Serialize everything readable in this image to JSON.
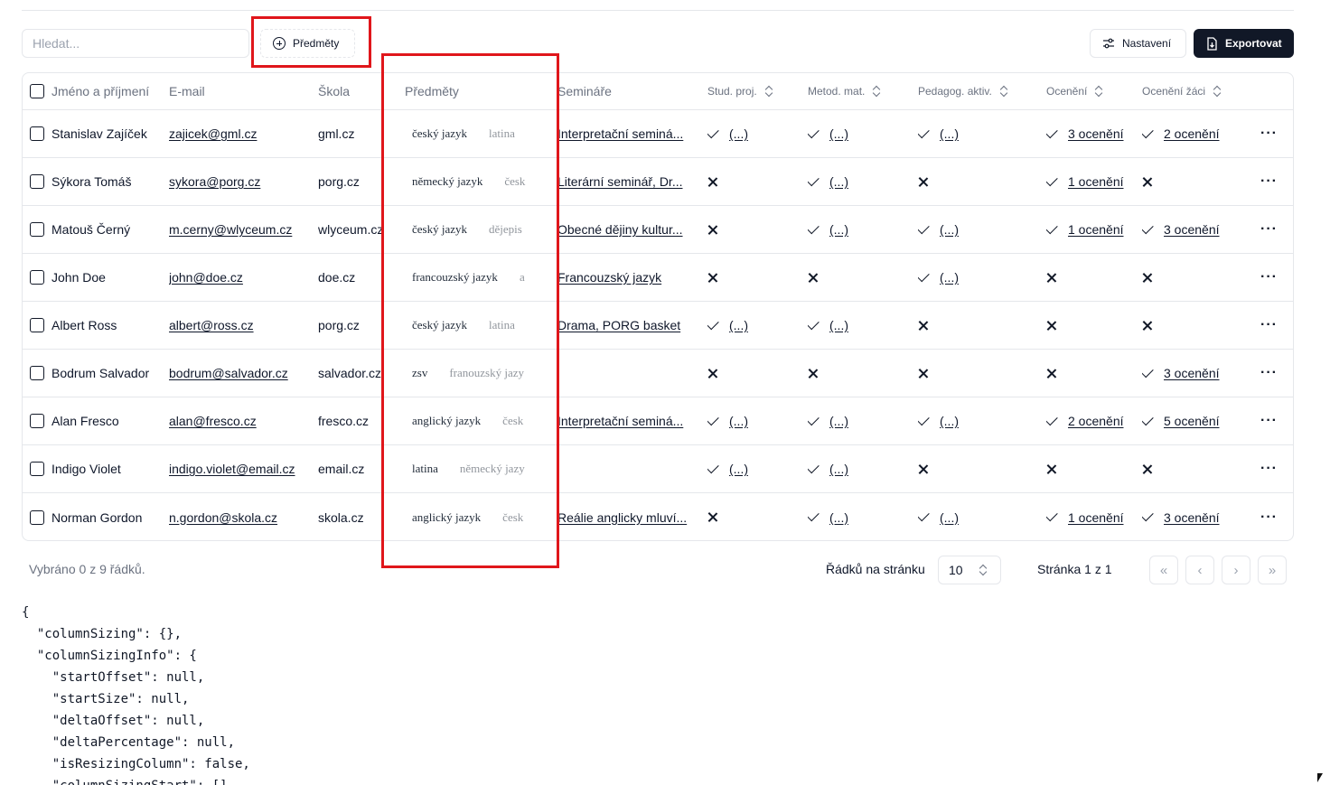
{
  "toolbar": {
    "search_placeholder": "Hledat...",
    "facet_label": "Předměty",
    "settings_label": "Nastavení",
    "export_label": "Exportovat"
  },
  "table": {
    "columns": {
      "name": "Jméno a příjmení",
      "email": "E-mail",
      "school": "Škola",
      "subjects": "Předměty",
      "seminars": "Semináře",
      "stud_proj": "Stud. proj.",
      "metod_mat": "Metod. mat.",
      "pedagog_aktiv": "Pedagog. aktiv.",
      "oceneni": "Ocenění",
      "oceneni_zaci": "Ocenění žáci"
    },
    "ellipsis_label": "(...)",
    "rows": [
      {
        "name": "Stanislav Zajíček",
        "email": "zajicek@gml.cz",
        "school": "gml.cz",
        "subject1": "český jazyk",
        "subject2": "latina",
        "seminar": "Interpretační seminá...",
        "stud_proj": true,
        "metod_mat": true,
        "pedagog": true,
        "oceneni": "3 ocenění",
        "oceneni_zaci": "2 ocenění"
      },
      {
        "name": "Sýkora Tomáš",
        "email": "sykora@porg.cz",
        "school": "porg.cz",
        "subject1": "německý jazyk",
        "subject2": "česk",
        "seminar": "Literární seminář, Dr...",
        "stud_proj": false,
        "metod_mat": true,
        "pedagog": false,
        "oceneni": "1 ocenění",
        "oceneni_zaci": ""
      },
      {
        "name": "Matouš Černý",
        "email": "m.cerny@wlyceum.cz",
        "school": "wlyceum.cz",
        "subject1": "český jazyk",
        "subject2": "dějepis",
        "seminar": "Obecné dějiny kultur...",
        "stud_proj": false,
        "metod_mat": true,
        "pedagog": true,
        "oceneni": "1 ocenění",
        "oceneni_zaci": "3 ocenění"
      },
      {
        "name": "John Doe",
        "email": "john@doe.cz",
        "school": "doe.cz",
        "subject1": "francouzský jazyk",
        "subject2": "a",
        "seminar": "Francouzský jazyk",
        "stud_proj": false,
        "metod_mat": false,
        "pedagog": true,
        "oceneni": "",
        "oceneni_zaci": ""
      },
      {
        "name": "Albert Ross",
        "email": "albert@ross.cz",
        "school": "porg.cz",
        "subject1": "český jazyk",
        "subject2": "latina",
        "seminar": "Drama, PORG basket",
        "stud_proj": true,
        "metod_mat": true,
        "pedagog": false,
        "oceneni": "",
        "oceneni_zaci": ""
      },
      {
        "name": "Bodrum Salvador",
        "email": "bodrum@salvador.cz",
        "school": "salvador.cz",
        "subject1": "zsv",
        "subject2": "franouzský jazy",
        "seminar": "",
        "stud_proj": false,
        "metod_mat": false,
        "pedagog": false,
        "oceneni": "",
        "oceneni_zaci": "3 ocenění"
      },
      {
        "name": "Alan Fresco",
        "email": "alan@fresco.cz",
        "school": "fresco.cz",
        "subject1": "anglický jazyk",
        "subject2": "česk",
        "seminar": "Interpretační seminá...",
        "stud_proj": true,
        "metod_mat": true,
        "pedagog": true,
        "oceneni": "2 ocenění",
        "oceneni_zaci": "5 ocenění"
      },
      {
        "name": "Indigo Violet",
        "email": "indigo.violet@email.cz",
        "school": "email.cz",
        "subject1": "latina",
        "subject2": "německý jazy",
        "seminar": "",
        "stud_proj": true,
        "metod_mat": true,
        "pedagog": false,
        "oceneni": "",
        "oceneni_zaci": ""
      },
      {
        "name": "Norman Gordon",
        "email": "n.gordon@skola.cz",
        "school": "skola.cz",
        "subject1": "anglický jazyk",
        "subject2": "česk",
        "seminar": "Reálie anglicky mluví...",
        "stud_proj": false,
        "metod_mat": true,
        "pedagog": true,
        "oceneni": "1 ocenění",
        "oceneni_zaci": "3 ocenění"
      }
    ]
  },
  "footer": {
    "selected_text": "Vybráno 0 z 9 řádků.",
    "rows_per_page_label": "Řádků na stránku",
    "rows_per_page_value": "10",
    "page_text": "Stránka 1 z 1",
    "first_icon": "«",
    "prev_icon": "‹",
    "next_icon": "›",
    "last_icon": "»"
  },
  "code_lines": [
    "{",
    "  \"columnSizing\": {},",
    "  \"columnSizingInfo\": {",
    "    \"startOffset\": null,",
    "    \"startSize\": null,",
    "    \"deltaOffset\": null,",
    "    \"deltaPercentage\": null,",
    "    \"isResizingColumn\": false,",
    "    \"columnSizingStart\": []"
  ],
  "colors": {
    "highlight": "#e0161b",
    "primary": "#111827",
    "border": "#e5e7eb",
    "muted": "#6b7280"
  }
}
